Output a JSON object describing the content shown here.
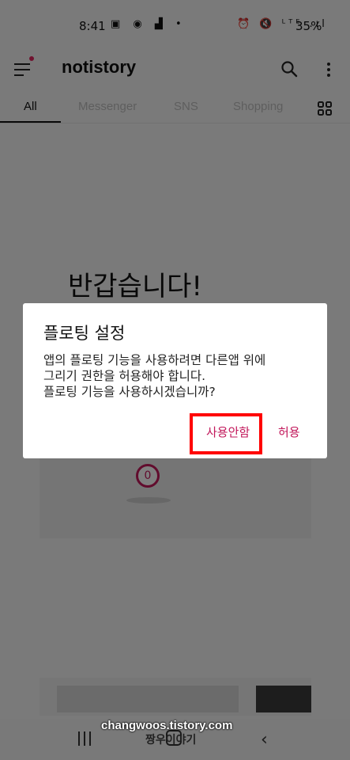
{
  "status_bar": {
    "time": "8:41",
    "left_icons": "▣ ◉ ▟ •",
    "right_icons": "⏰ 🔇 ᴸᵀᴱ .ıl",
    "battery": "35%"
  },
  "app_bar": {
    "title": "notistory",
    "menu_icon": "menu-icon",
    "search_icon": "search-icon",
    "more_icon": "more-vert-icon"
  },
  "tabs": [
    {
      "label": "All",
      "active": true
    },
    {
      "label": "Messenger",
      "active": false
    },
    {
      "label": "SNS",
      "active": false
    },
    {
      "label": "Shopping",
      "active": false
    }
  ],
  "welcome_text": "반갑습니다!",
  "illustration_badge": "0",
  "dialog": {
    "title": "플로팅 설정",
    "body_lines": [
      "앱의 플로팅 기능을 사용하려면 다른앱 위에",
      "그리기 권한을 허용해야 합니다.",
      "플로팅 기능을 사용하시겠습니까?"
    ],
    "deny_label": "사용안함",
    "allow_label": "허용",
    "button_color": "#c2185b",
    "highlight_color": "#ff0000"
  },
  "watermark": "changwoos.tistory.com",
  "watermark_sub": "짱우이야기",
  "colors": {
    "accent": "#c2185b",
    "notification_dot": "#e0245e"
  }
}
